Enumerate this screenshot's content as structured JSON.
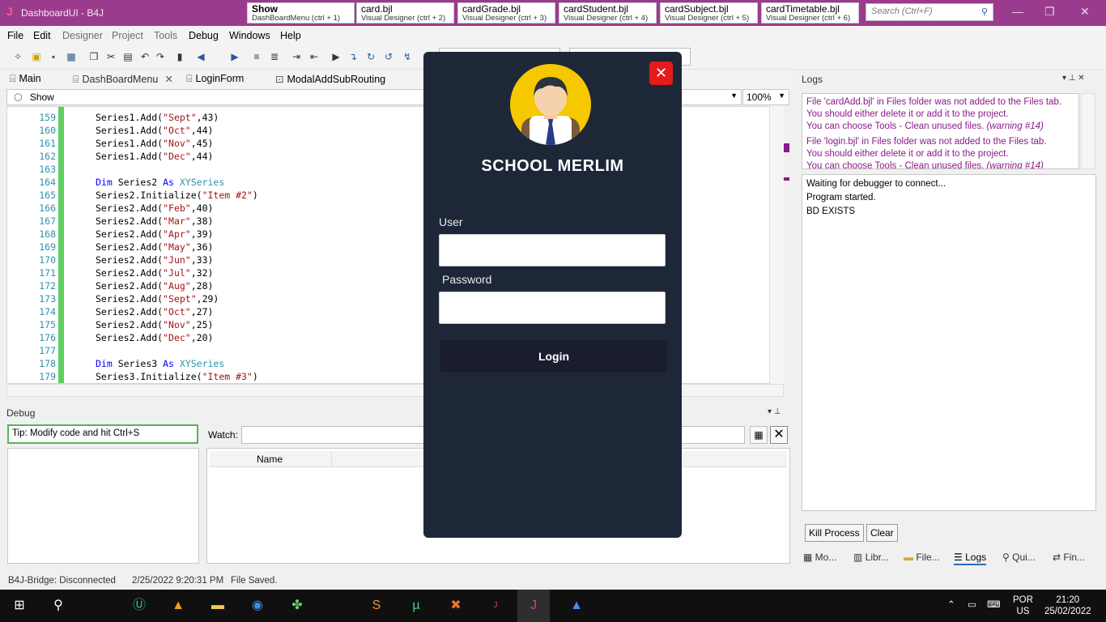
{
  "app": {
    "title": "DashboardUI - B4J",
    "icon_letter": "J"
  },
  "doc_tabs": [
    {
      "name": "Show",
      "sub": "DashBoardMenu  (ctrl + 1)"
    },
    {
      "name": "card.bjl",
      "sub": "Visual Designer  (ctrl + 2)"
    },
    {
      "name": "cardGrade.bjl",
      "sub": "Visual Designer  (ctrl + 3)"
    },
    {
      "name": "cardStudent.bjl",
      "sub": "Visual Designer  (ctrl + 4)"
    },
    {
      "name": "cardSubject.bjl",
      "sub": "Visual Designer  (ctrl + 5)"
    },
    {
      "name": "cardTimetable.bjl",
      "sub": "Visual Designer  (ctrl + 6)"
    }
  ],
  "search": {
    "placeholder": "Search (Ctrl+F)"
  },
  "menu": [
    "File",
    "Edit",
    "Designer",
    "Project",
    "Tools",
    "Debug",
    "Windows",
    "Help"
  ],
  "editor_tabs": [
    "Main",
    "DashBoardMenu",
    "LoginForm",
    "ModalAddSubRouting"
  ],
  "sub_combo": {
    "value": "Show"
  },
  "zoom": {
    "value": "100%"
  },
  "code_lines": [
    {
      "n": "159",
      "code": "Series1.Add(\"Sept\",43)"
    },
    {
      "n": "160",
      "code": "Series1.Add(\"Oct\",44)"
    },
    {
      "n": "161",
      "code": "Series1.Add(\"Nov\",45)"
    },
    {
      "n": "162",
      "code": "Series1.Add(\"Dec\",44)"
    },
    {
      "n": "163",
      "code": ""
    },
    {
      "n": "164",
      "code": "Dim Series2 As XYSeries"
    },
    {
      "n": "165",
      "code": "Series2.Initialize(\"Item #2\")"
    },
    {
      "n": "166",
      "code": "Series2.Add(\"Feb\",40)"
    },
    {
      "n": "167",
      "code": "Series2.Add(\"Mar\",38)"
    },
    {
      "n": "168",
      "code": "Series2.Add(\"Apr\",39)"
    },
    {
      "n": "169",
      "code": "Series2.Add(\"May\",36)"
    },
    {
      "n": "170",
      "code": "Series2.Add(\"Jun\",33)"
    },
    {
      "n": "171",
      "code": "Series2.Add(\"Jul\",32)"
    },
    {
      "n": "172",
      "code": "Series2.Add(\"Aug\",28)"
    },
    {
      "n": "173",
      "code": "Series2.Add(\"Sept\",29)"
    },
    {
      "n": "174",
      "code": "Series2.Add(\"Oct\",27)"
    },
    {
      "n": "175",
      "code": "Series2.Add(\"Nov\",25)"
    },
    {
      "n": "176",
      "code": "Series2.Add(\"Dec\",20)"
    },
    {
      "n": "177",
      "code": ""
    },
    {
      "n": "178",
      "code": "Dim Series3 As XYSeries"
    },
    {
      "n": "179",
      "code": "Series3.Initialize(\"Item #3\")"
    }
  ],
  "debug": {
    "title": "Debug",
    "tip": "Tip: Modify code and hit Ctrl+S",
    "watch_label": "Watch:",
    "watch_col_name": "Name"
  },
  "logs": {
    "title": "Logs",
    "warnings": [
      {
        "lines": [
          "File 'cardAdd.bjl' in Files folder was not added to the Files tab.",
          "You should either delete it or add it to the project."
        ],
        "last": "You can choose Tools - Clean unused files.",
        "tag": "(warning #14)"
      },
      {
        "lines": [
          "File 'login.bjl' in Files folder was not added to the Files tab.",
          "You should either delete it or add it to the project."
        ],
        "last": "You can choose Tools - Clean unused files.",
        "tag": "(warning #14)"
      }
    ],
    "output": [
      "Waiting for debugger to connect...",
      "Program started.",
      "BD EXISTS"
    ],
    "kill_label": "Kill Process",
    "clear_label": "Clear"
  },
  "panel_tabs": [
    "Mo...",
    "Libr...",
    "File...",
    "Logs",
    "Qui...",
    "Fin..."
  ],
  "status": {
    "bridge": "B4J-Bridge: Disconnected",
    "datetime": "2/25/2022 9:20:31 PM",
    "saved": "File Saved."
  },
  "taskbar": {
    "lang": "POR",
    "region": "US",
    "time": "21:20",
    "date": "25/02/2022"
  },
  "modal": {
    "school_name": "SCHOOL MERLIM",
    "user_label": "User",
    "password_label": "Password",
    "login_label": "Login",
    "close_glyph": "✕"
  },
  "colors": {
    "title_bar": "#9b3b8e",
    "modal_bg": "#1e2738",
    "close_red": "#e31b1b",
    "avatar_yellow": "#f6c800",
    "warning_purple": "#8a1a8a"
  }
}
